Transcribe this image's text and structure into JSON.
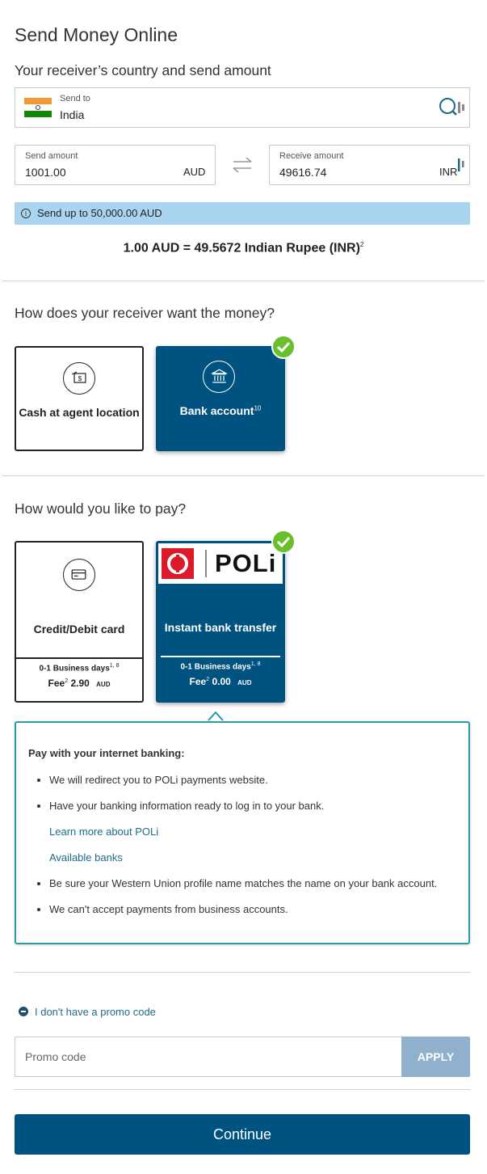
{
  "page": {
    "title": "Send Money Online",
    "section_country": "Your receiver’s country and send amount"
  },
  "send_to": {
    "label": "Send to",
    "value": "India"
  },
  "send_amount": {
    "label": "Send amount",
    "value": "1001.00",
    "currency": "AUD"
  },
  "receive_amount": {
    "label": "Receive amount",
    "value": "49616.74",
    "currency": "INR"
  },
  "info": {
    "text": "Send up to 50,000.00 AUD"
  },
  "rate": {
    "text": "1.00 AUD = 49.5672 Indian Rupee (INR)",
    "sup": "2"
  },
  "receive_method": {
    "heading": "How does your receiver want the money?",
    "options": [
      {
        "label": "Cash at agent location",
        "selected": false
      },
      {
        "label": "Bank account",
        "sup": "10",
        "selected": true
      }
    ]
  },
  "pay_method": {
    "heading": "How would you like to pay?",
    "options": [
      {
        "label": "Credit/Debit card",
        "days": "0-1 Business days",
        "days_sup": "1, 8",
        "fee_label": "Fee",
        "fee_sup": "2",
        "fee_value": "2.90",
        "fee_currency": "AUD",
        "selected": false
      },
      {
        "label": "Instant bank transfer",
        "brand": "POLi",
        "days": "0-1 Business days",
        "days_sup": "1, 8",
        "fee_label": "Fee",
        "fee_sup": "2",
        "fee_value": "0.00",
        "fee_currency": "AUD",
        "selected": true
      }
    ]
  },
  "poli_info": {
    "heading": "Pay with your internet banking:",
    "bullet1": "We will redirect you to POLi payments website.",
    "bullet2": "Have your banking information ready to log in to your bank.",
    "link1": "Learn more about POLi",
    "link2": "Available banks",
    "bullet3": "Be sure your Western Union profile name matches the name on your bank account.",
    "bullet4": "We can't accept payments from business accounts."
  },
  "promo": {
    "toggle_label": "I don't have a promo code",
    "placeholder": "Promo code",
    "apply_label": "APPLY"
  },
  "continue_label": "Continue",
  "colors": {
    "primary": "#005380",
    "check_green": "#6abf2d",
    "info_bar": "#a9d5f0",
    "border_teal": "#2a9aa8",
    "link": "#1f6b8a",
    "apply_disabled": "#8fb1cd"
  }
}
